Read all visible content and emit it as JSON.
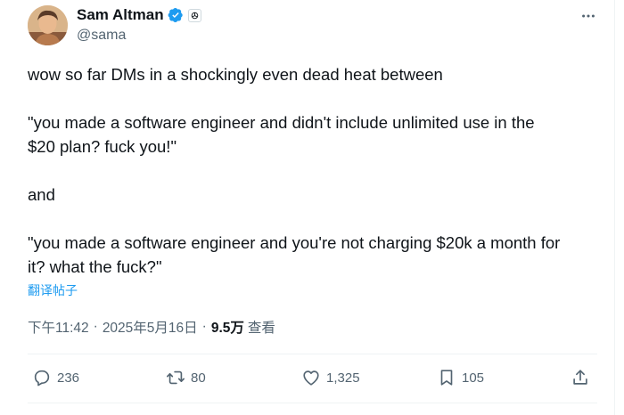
{
  "author": {
    "display_name": "Sam Altman",
    "handle": "@sama",
    "verified_icon": "verified-badge-icon",
    "affiliate_icon": "openai-logo-icon"
  },
  "tweet": {
    "lines": [
      "wow so far DMs in a shockingly even dead heat between",
      "\"you made a software engineer and didn't include unlimited use in the\n$20 plan? fuck you!\"",
      "and",
      "\"you made a software engineer and you're not charging $20k a month for\nit? what the fuck?\""
    ],
    "translate_label": "翻译帖子"
  },
  "meta": {
    "time": "下午11:42",
    "separator": "·",
    "date": "2025年5月16日",
    "views_count": "9.5万",
    "views_label": "查看"
  },
  "actions": {
    "replies": "236",
    "reposts": "80",
    "likes": "1,325",
    "bookmarks": "105"
  },
  "colors": {
    "accent": "#1d9bf0",
    "text": "#0f1419",
    "secondary": "#536471"
  }
}
